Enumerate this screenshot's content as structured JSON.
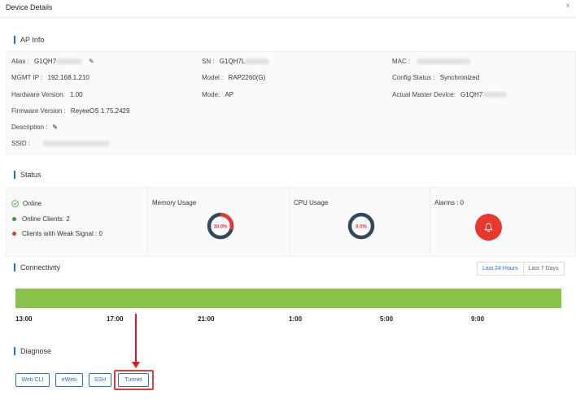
{
  "header": {
    "title": "Device Details",
    "close": "×"
  },
  "ap_info": {
    "section_title": "AP Info",
    "alias_label": "Alias :",
    "alias_value": "G1QH7",
    "sn_label": "SN :",
    "sn_value": "G1QH7L",
    "mac_label": "MAC :",
    "mgmt_ip_label": "MGMT IP :",
    "mgmt_ip_value": "192.168.1.210",
    "model_label": "Model :",
    "model_value": "RAP2260(G)",
    "config_status_label": "Config Status :",
    "config_status_value": "Synchronized",
    "hardware_version_label": "Hardware Version:",
    "hardware_version_value": "1.00",
    "mode_label": "Mode:",
    "mode_value": "AP",
    "actual_master_label": "Actual Master Device:",
    "actual_master_value": "G1QH7",
    "firmware_label": "Firmware Version :",
    "firmware_value": "ReyeeOS 1.75.2429",
    "description_label": "Description :",
    "ssid_label": "SSID :"
  },
  "status": {
    "section_title": "Status",
    "online_label": "Online",
    "online_clients_label": "Online Clients: 2",
    "weak_signal_label": "Clients with Weak Signal : 0",
    "memory_label": "Memory Usage",
    "memory_value": "30.0%",
    "memory_fraction": 0.3,
    "cpu_label": "CPU Usage",
    "cpu_value": "0.0%",
    "cpu_fraction": 0.0,
    "alarms_label": "Alarms : 0",
    "colors": {
      "online": "#2e9e34",
      "weak": "#e8372e",
      "gauge_track": "#34495e",
      "gauge_fill": "#e8372e",
      "alarm": "#e8372e"
    }
  },
  "connectivity": {
    "section_title": "Connectivity",
    "tabs": [
      "Last 24 Hours",
      "Last 7 Days"
    ],
    "active_tab": "Last 24 Hours",
    "timeline_color": "#8bc34a",
    "ticks": [
      "13:00",
      "17:00",
      "21:00",
      "1:00",
      "5:00",
      "9:00"
    ]
  },
  "diagnose": {
    "section_title": "Diagnose",
    "buttons": [
      "Web CLI",
      "eWeb",
      "SSH",
      "Tunnel"
    ],
    "highlight_color": "#e23b3b",
    "arrow_color": "#e8131a"
  },
  "icons": {
    "close": "close-icon",
    "pencil": "pencil-icon",
    "check": "check-circle-icon",
    "bell": "bell-icon"
  }
}
